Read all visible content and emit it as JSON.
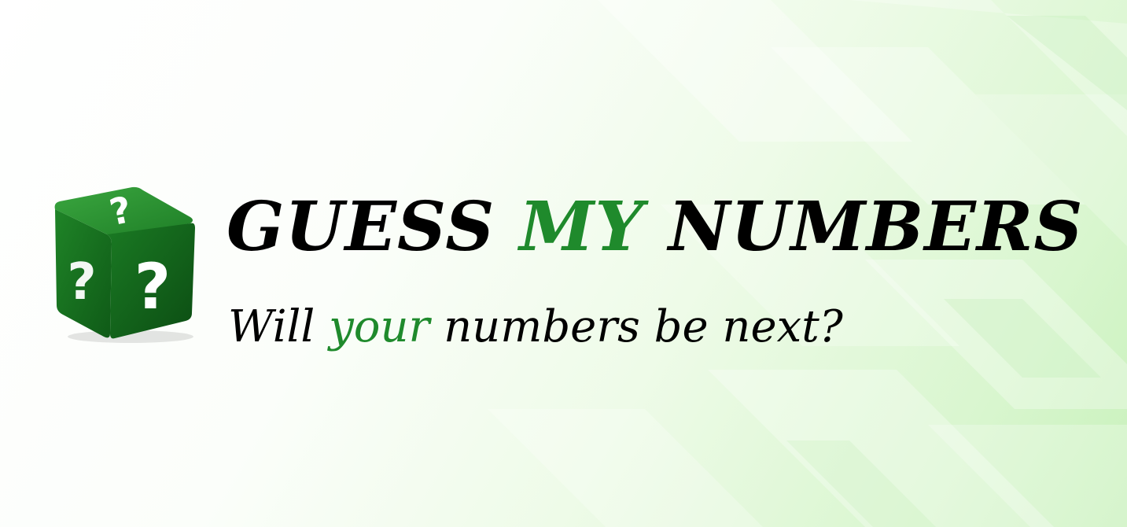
{
  "banner": {
    "title": {
      "part1": "GUESS ",
      "part2": "MY",
      "part3": " NUMBERS"
    },
    "tagline": {
      "part1": "Will ",
      "part2": "your",
      "part3": " numbers be next?"
    },
    "logo": {
      "icon": "question-dice-icon",
      "glyph": "?"
    }
  },
  "colors": {
    "accent_green": "#1f8a2c",
    "text_black": "#000000",
    "cube_green": "#1b7a25",
    "background_light_green": "#c8f1bb"
  }
}
